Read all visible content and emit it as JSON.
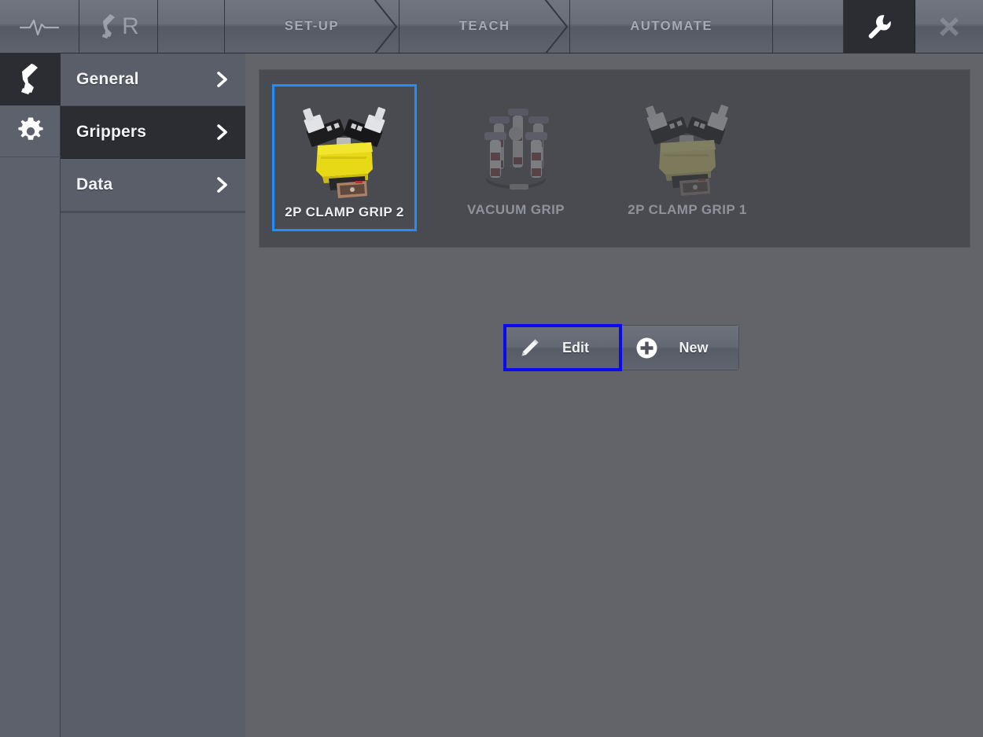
{
  "topbar": {
    "cells": [
      {
        "type": "icon",
        "name": "status-pulse-icon",
        "label": "",
        "icon": "pulse-icon"
      },
      {
        "type": "icon",
        "name": "robot-program-icon",
        "label": "R",
        "icon": "robot-arm-r-icon"
      },
      {
        "type": "blank",
        "name": "topbar-spacer-1",
        "label": "",
        "icon": ""
      },
      {
        "type": "step",
        "name": "tab-set-up",
        "label": "SET-UP",
        "icon": ""
      },
      {
        "type": "step",
        "name": "tab-teach",
        "label": "TEACH",
        "icon": ""
      },
      {
        "type": "step",
        "name": "tab-automate",
        "label": "AUTOMATE",
        "icon": ""
      },
      {
        "type": "blank",
        "name": "topbar-spacer-2",
        "label": "",
        "icon": ""
      },
      {
        "type": "tool",
        "name": "tab-settings",
        "label": "",
        "icon": "wrench-icon"
      },
      {
        "type": "close",
        "name": "close-button",
        "label": "",
        "icon": "close-icon"
      }
    ],
    "active_tab": "tab-settings"
  },
  "rail": {
    "items": [
      {
        "name": "rail-item-robot",
        "icon": "robot-arm-icon",
        "active": true
      },
      {
        "name": "rail-item-settings",
        "icon": "gear-icon",
        "active": false
      }
    ]
  },
  "sidebar": {
    "items": [
      {
        "label": "General",
        "active": false
      },
      {
        "label": "Grippers",
        "active": true
      },
      {
        "label": "Data",
        "active": false
      }
    ],
    "chevron_icon": "chevron-right-icon"
  },
  "main": {
    "grippers": [
      {
        "label": "2P CLAMP GRIP 2",
        "art": "clamp-gripper",
        "selected": true,
        "dimmed": false
      },
      {
        "label": "VACUUM GRIP",
        "art": "vacuum-gripper",
        "selected": false,
        "dimmed": true
      },
      {
        "label": "2P CLAMP GRIP 1",
        "art": "clamp-gripper",
        "selected": false,
        "dimmed": true
      }
    ],
    "actions": [
      {
        "label": "Edit",
        "icon": "pencil-icon",
        "focused": true
      },
      {
        "label": "New",
        "icon": "plus-circle-icon",
        "focused": false
      }
    ]
  },
  "colors": {
    "selection_blue": "#1e8fff",
    "focus_blue": "#0a0af0",
    "panel_bg": "#4a4b51",
    "main_bg": "#636469",
    "chrome_bg": "#5a5e69",
    "active_dark": "#2b2d33",
    "gripper_yellow": "#e8d917",
    "vacuum_purple": "#7b7fae"
  }
}
